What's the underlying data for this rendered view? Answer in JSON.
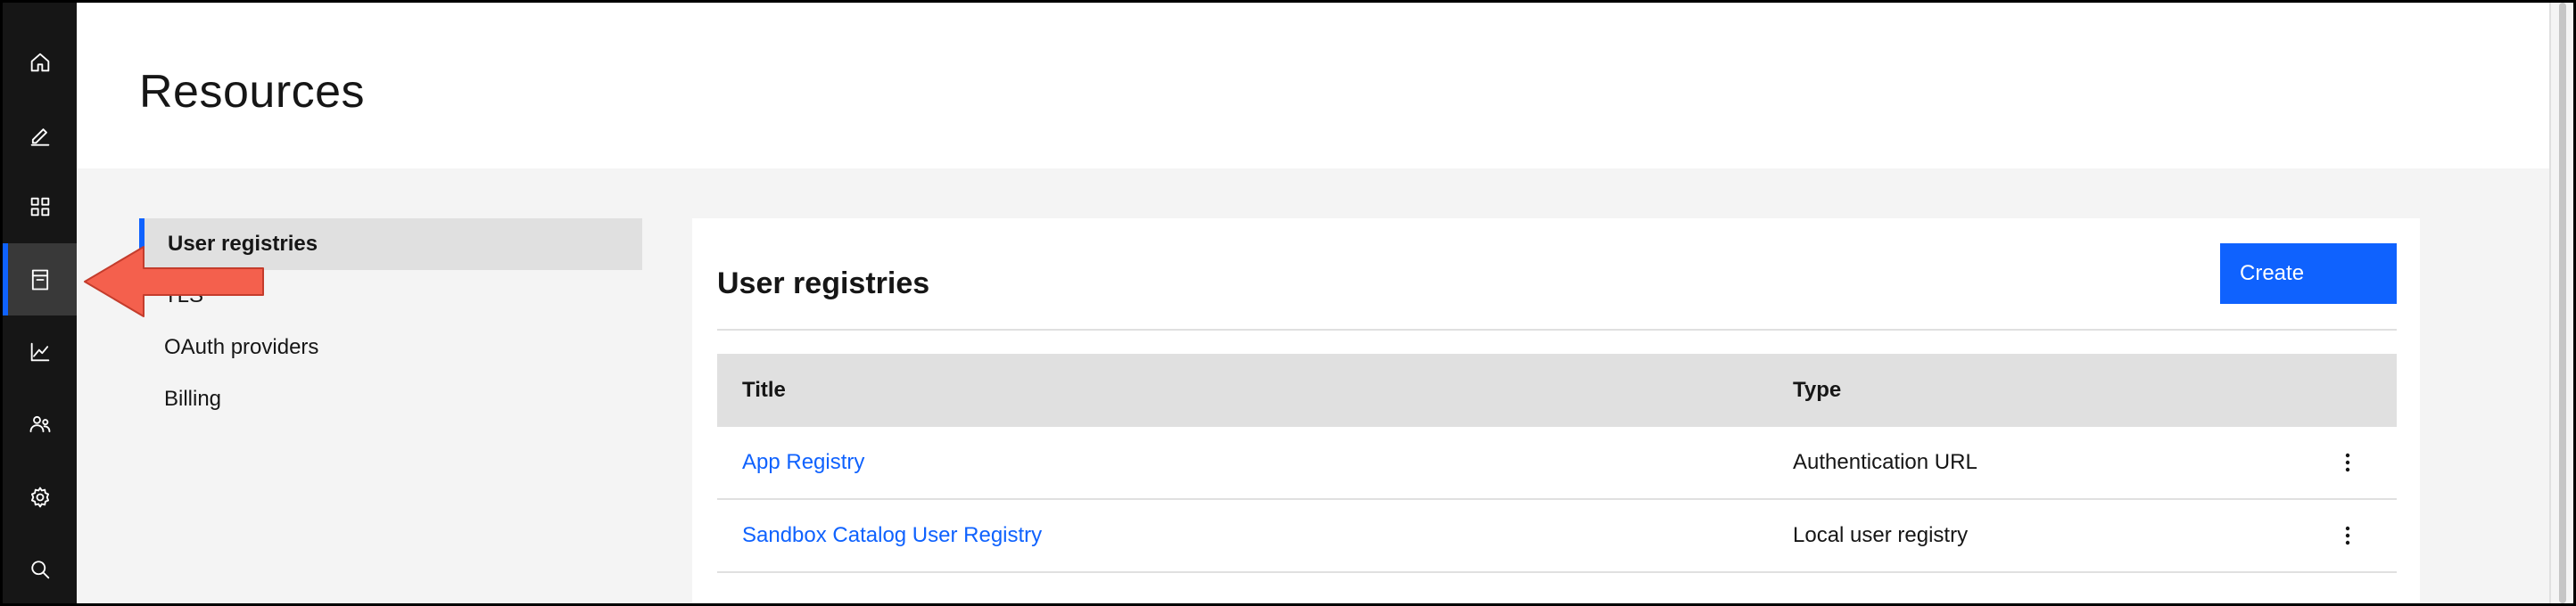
{
  "page": {
    "title": "Resources"
  },
  "rail": {
    "items": [
      {
        "icon": "home-icon"
      },
      {
        "icon": "edit-icon"
      },
      {
        "icon": "apps-grid-icon"
      },
      {
        "icon": "archive-icon",
        "active": true
      },
      {
        "icon": "analytics-icon"
      },
      {
        "icon": "users-icon"
      },
      {
        "icon": "settings-icon"
      },
      {
        "icon": "search-icon"
      }
    ]
  },
  "side_nav": {
    "items": [
      {
        "label": "User registries",
        "active": true
      },
      {
        "label": "TLS"
      },
      {
        "label": "OAuth providers"
      },
      {
        "label": "Billing"
      }
    ]
  },
  "card": {
    "title": "User registries",
    "create_label": "Create"
  },
  "table": {
    "headers": {
      "title": "Title",
      "type": "Type"
    },
    "rows": [
      {
        "title": "App Registry",
        "type": "Authentication URL"
      },
      {
        "title": "Sandbox Catalog User Registry",
        "type": "Local user registry"
      }
    ]
  },
  "colors": {
    "accent": "#0f62fe",
    "rail_bg": "#161616",
    "annotation_arrow": "#f4604d"
  }
}
